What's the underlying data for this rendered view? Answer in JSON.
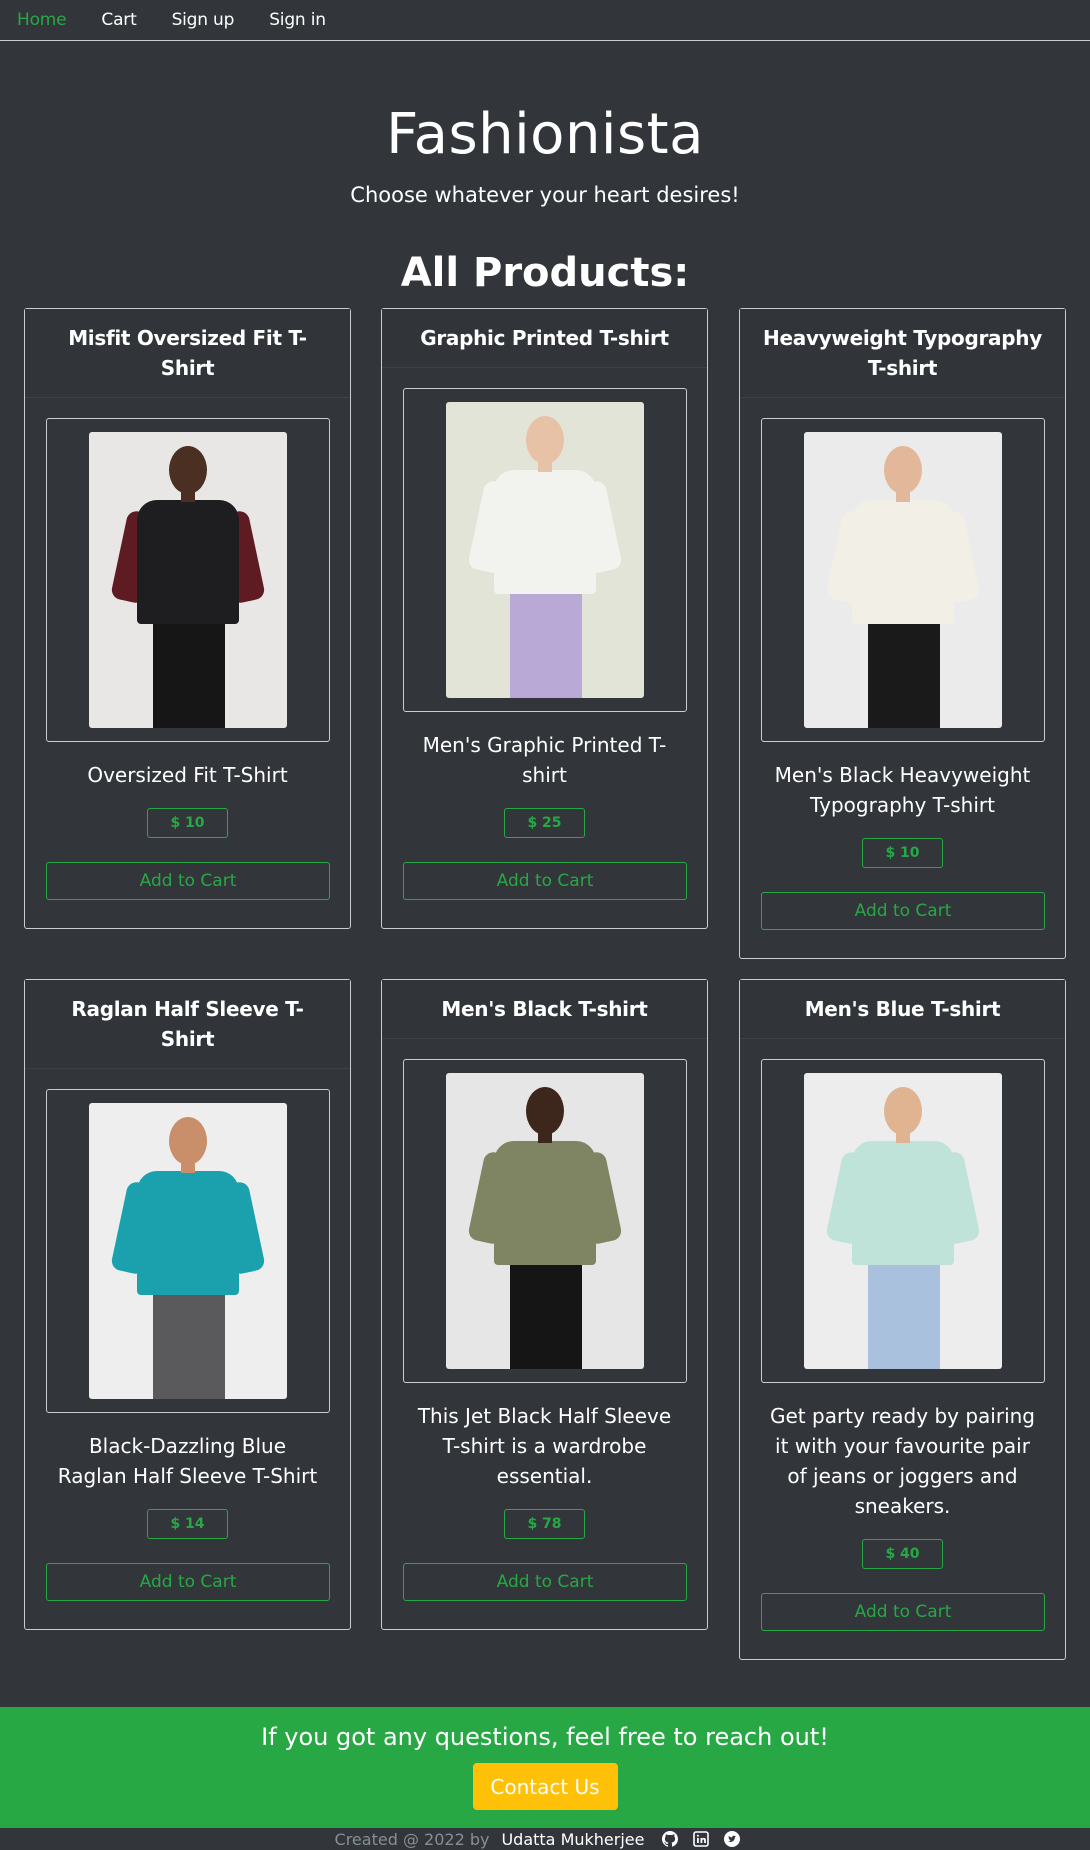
{
  "nav": {
    "items": [
      {
        "label": "Home",
        "active": true
      },
      {
        "label": "Cart",
        "active": false
      },
      {
        "label": "Sign up",
        "active": false
      },
      {
        "label": "Sign in",
        "active": false
      }
    ]
  },
  "hero": {
    "title": "Fashionista",
    "subtitle": "Choose whatever your heart desires!"
  },
  "products_title": "All Products:",
  "products": [
    {
      "title": "Misfit Oversized Fit T-Shirt",
      "description": "Oversized Fit T-Shirt",
      "price": "$ 10",
      "button": "Add to Cart",
      "image": "model-in-black-oversized-tshirt",
      "bg": "#e8e7e5",
      "shirt_color": "#1e1d1f",
      "sleeve_color": "#5e1c22",
      "pants_color": "#161616",
      "skin": "#4a2f22"
    },
    {
      "title": "Graphic Printed T-shirt",
      "description": "Men's Graphic Printed T-shirt",
      "price": "$ 25",
      "button": "Add to Cart",
      "image": "model-in-white-graphic-tshirt",
      "bg": "#e2e4d8",
      "shirt_color": "#f2f2ee",
      "sleeve_color": "#f2f2ee",
      "pants_color": "#b9a9d6",
      "skin": "#e8c2a6"
    },
    {
      "title": "Heavyweight Typography T-shirt",
      "description": "Men's Black Heavyweight Typography T-shirt",
      "price": "$ 10",
      "button": "Add to Cart",
      "image": "model-in-white-patterned-polo",
      "bg": "#ebebeb",
      "shirt_color": "#f1efe6",
      "sleeve_color": "#f1efe6",
      "pants_color": "#1a1a1a",
      "skin": "#e3b89a"
    },
    {
      "title": "Raglan Half Sleeve T-Shirt",
      "description": "Black-Dazzling Blue Raglan Half Sleeve T-Shirt",
      "price": "$ 14",
      "button": "Add to Cart",
      "image": "model-in-teal-tshirt",
      "bg": "#eeeeee",
      "shirt_color": "#1aa1ad",
      "sleeve_color": "#1aa1ad",
      "pants_color": "#5a5a5c",
      "skin": "#c98f6a"
    },
    {
      "title": "Men's Black T-shirt",
      "description": "This Jet Black Half Sleeve T-shirt is a wardrobe essential.",
      "price": "$ 78",
      "button": "Add to Cart",
      "image": "model-in-olive-tshirt",
      "bg": "#e6e6e6",
      "shirt_color": "#7f8563",
      "sleeve_color": "#7f8563",
      "pants_color": "#151515",
      "skin": "#3d261b"
    },
    {
      "title": "Men's Blue T-shirt",
      "description": "Get party ready by pairing it with your favourite pair of jeans or joggers and sneakers.",
      "price": "$ 40",
      "button": "Add to Cart",
      "image": "model-in-tie-dye-tshirt",
      "bg": "#ededed",
      "shirt_color": "#bfe3d9",
      "sleeve_color": "#bfe3d9",
      "pants_color": "#a9c1dc",
      "skin": "#e0b391"
    }
  ],
  "footer": {
    "question": "If you got any questions, feel free to reach out!",
    "contact_button": "Contact Us",
    "created": "Created @ 2022 by",
    "author": "Udatta Mukherjee",
    "social": [
      "github-icon",
      "linkedin-icon",
      "twitter-icon"
    ]
  },
  "colors": {
    "background": "#32363b",
    "accent": "#28a745",
    "contact_button": "#ffc107"
  }
}
